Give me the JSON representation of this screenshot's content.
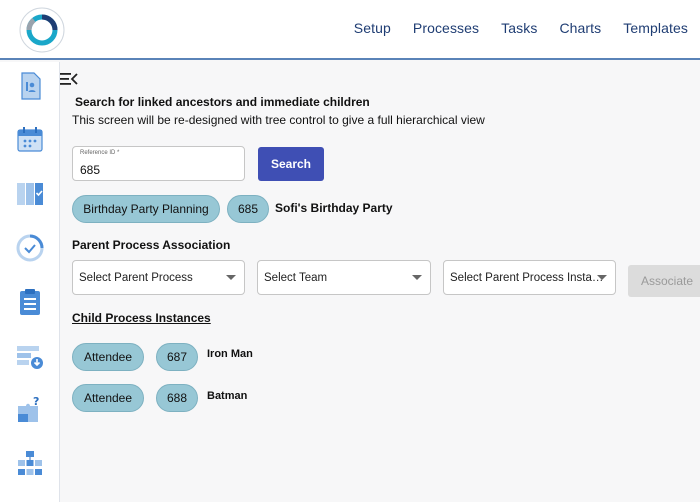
{
  "header": {
    "nav": [
      "Setup",
      "Processes",
      "Tasks",
      "Charts",
      "Templates"
    ]
  },
  "sidebar": {
    "icons": [
      "document-person-icon",
      "calendar-icon",
      "board-check-icon",
      "clock-check-icon",
      "clipboard-list-icon",
      "layout-download-icon",
      "puzzle-question-icon",
      "hierarchy-icon"
    ]
  },
  "search": {
    "heading": "Search for linked ancestors and immediate children",
    "note": "This screen will be re-designed with tree control to give a full hierarchical view",
    "reference_label": "Reference ID *",
    "reference_value": "685",
    "button": "Search"
  },
  "result": {
    "process_name": "Birthday Party Planning",
    "instance_id": "685",
    "instance_title": "Sofi's Birthday Party"
  },
  "parent": {
    "heading": "Parent Process Association",
    "select_process": "Select Parent Process",
    "select_team": "Select Team",
    "select_instance": "Select Parent Process Insta…",
    "associate_button": "Associate"
  },
  "children": {
    "heading": "Child Process Instances",
    "rows": [
      {
        "role": "Attendee",
        "id": "687",
        "name": "Iron Man"
      },
      {
        "role": "Attendee",
        "id": "688",
        "name": "Batman"
      }
    ]
  }
}
